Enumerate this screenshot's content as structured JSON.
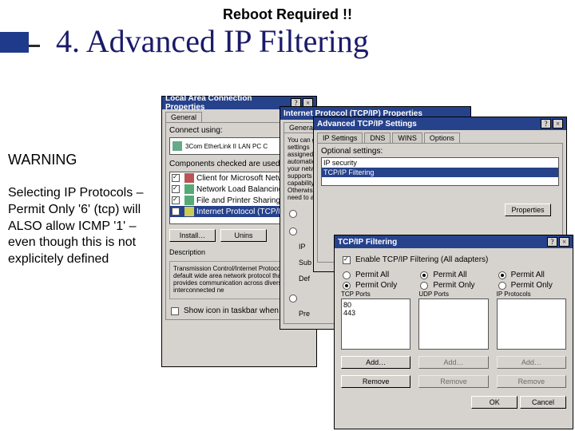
{
  "header": {
    "reboot": "Reboot Required !!",
    "title": "4. Advanced IP Filtering"
  },
  "sidebar": {
    "warning": "WARNING",
    "body": "Selecting IP Protocols – Permit Only '6' (tcp) will ALSO allow ICMP '1' – even though this is not explicitely defined"
  },
  "w1": {
    "title": "Local Area Connection Properties",
    "tab": "General",
    "connect_label": "Connect using:",
    "adapter": "3Com EtherLink II LAN PC C",
    "comps_label": "Components checked are used by",
    "items": [
      "Client for Microsoft Network",
      "Network Load Balancing",
      "File and Printer Sharing for",
      "Internet Protocol (TCP/IP)"
    ],
    "install": "Install…",
    "uninstall": "Unins",
    "desc_label": "Description",
    "desc": "Transmission Control/Internet Protocol. The default wide area network protocol that provides communication across diverse interconnected ne",
    "taskbar": "Show icon in taskbar when con"
  },
  "w2": {
    "title": "Internet Protocol (TCP/IP) Properties",
    "tab": "General",
    "blurb": "You can get IP settings assigned automatically if your network supports this capability. Otherwise, you need to ask",
    "labels": {
      "ip": "IP",
      "sub": "Sub",
      "def": "Def",
      "pre": "Pre"
    }
  },
  "w3": {
    "title": "Advanced TCP/IP Settings",
    "tabs": [
      "IP Settings",
      "DNS",
      "WINS",
      "Options"
    ],
    "opt_label": "Optional settings:",
    "options": [
      "IP security",
      "TCP/IP Filtering"
    ],
    "properties": "Properties"
  },
  "w4": {
    "title": "TCP/IP Filtering",
    "enable": "Enable TCP/IP Filtering (All adapters)",
    "permit_all": "Permit All",
    "permit_only": "Permit Only",
    "cols": [
      "TCP Ports",
      "UDP Ports",
      "IP Protocols"
    ],
    "tcp": [
      "80",
      "443"
    ],
    "add": "Add…",
    "remove": "Remove",
    "ok": "OK",
    "cancel": "Cancel"
  }
}
